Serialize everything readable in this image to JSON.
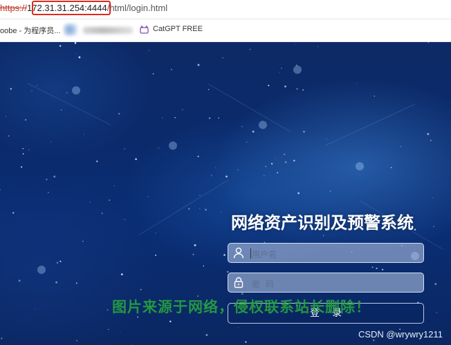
{
  "browser": {
    "url": {
      "scheme": "https://",
      "host": "172.31.31.254:4444",
      "path": "/html/login.html"
    },
    "bookmarks": [
      {
        "label": "oobe - 为程序员..."
      },
      {
        "label": "CatGPT FREE",
        "icon": "catgpt-icon"
      }
    ]
  },
  "login": {
    "title": "网络资产识别及预警系统",
    "username_placeholder": "用户名",
    "password_placeholder": "密码",
    "submit_label": "登录"
  },
  "overlays": {
    "watermark": "图片来源于网络，侵权联系站长删除！",
    "credit": "CSDN @wrywry1211"
  },
  "colors": {
    "background": "#0b2a6b",
    "highlight_box": "#e3271c",
    "watermark": "#28aa3c"
  }
}
